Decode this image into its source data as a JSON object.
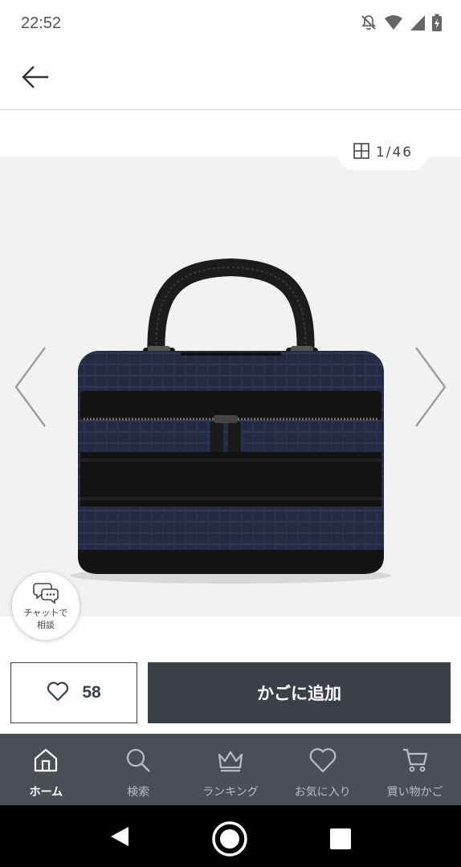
{
  "status_bar": {
    "time": "22:52",
    "icons": [
      "notifications-off-icon",
      "wifi-icon",
      "signal-icon",
      "battery-charging-icon"
    ]
  },
  "header": {
    "back_icon": "arrow-left-icon"
  },
  "gallery": {
    "counter_icon": "grid-icon",
    "counter_text": "1/46",
    "current_index": 1,
    "total": 46,
    "prev_icon": "chevron-left-icon",
    "next_icon": "chevron-right-icon",
    "product_image": "navy-briefcase-bag"
  },
  "chat": {
    "icon": "chat-bubbles-icon",
    "label_line1": "チャットで",
    "label_line2": "相談"
  },
  "actions": {
    "favorite_icon": "heart-icon",
    "favorite_count": "58",
    "add_to_cart_label": "かごに追加"
  },
  "bottom_nav": {
    "items": [
      {
        "label": "ホーム",
        "icon": "home-icon",
        "active": true
      },
      {
        "label": "検索",
        "icon": "search-icon",
        "active": false
      },
      {
        "label": "ランキング",
        "icon": "crown-icon",
        "active": false
      },
      {
        "label": "お気に入り",
        "icon": "heart-icon",
        "active": false
      },
      {
        "label": "買い物かご",
        "icon": "cart-icon",
        "active": false
      }
    ]
  },
  "colors": {
    "primary_dark": "#3b3f47",
    "nav_background": "#4a4e56",
    "gallery_background": "#f2f2f2"
  }
}
